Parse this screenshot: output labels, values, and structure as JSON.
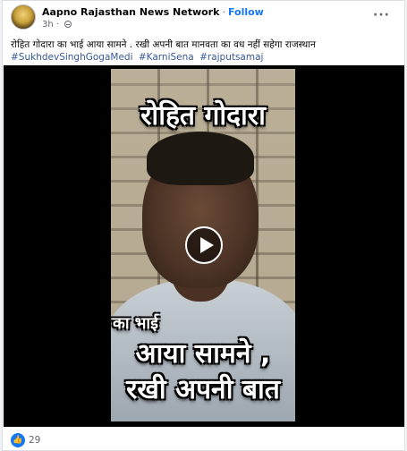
{
  "post": {
    "page_name": "Aapno Rajasthan News Network",
    "separator": "·",
    "follow_label": "Follow",
    "time": "3h",
    "visibility_icon": "globe-icon",
    "more_label": "···",
    "caption": "रोहित गोदारा का भाई आया सामने . रखी अपनी बात मानवता का वध नहीं सहेगा राजस्थान",
    "hashtags": [
      "#SukhdevSinghGogaMedi",
      "#KarniSena",
      "#rajputsamaj"
    ]
  },
  "video": {
    "overlay_line1": "रोहित गोदारा",
    "overlay_line2": "का भाई",
    "overlay_line3": "आया सामने ,",
    "overlay_line4": "रखी अपनी बात",
    "play_icon": "play-icon"
  },
  "reactions": {
    "icon": "like-icon",
    "count": "29"
  },
  "colors": {
    "accent": "#1877f2",
    "hashtag": "#385898",
    "muted": "#65676b"
  }
}
